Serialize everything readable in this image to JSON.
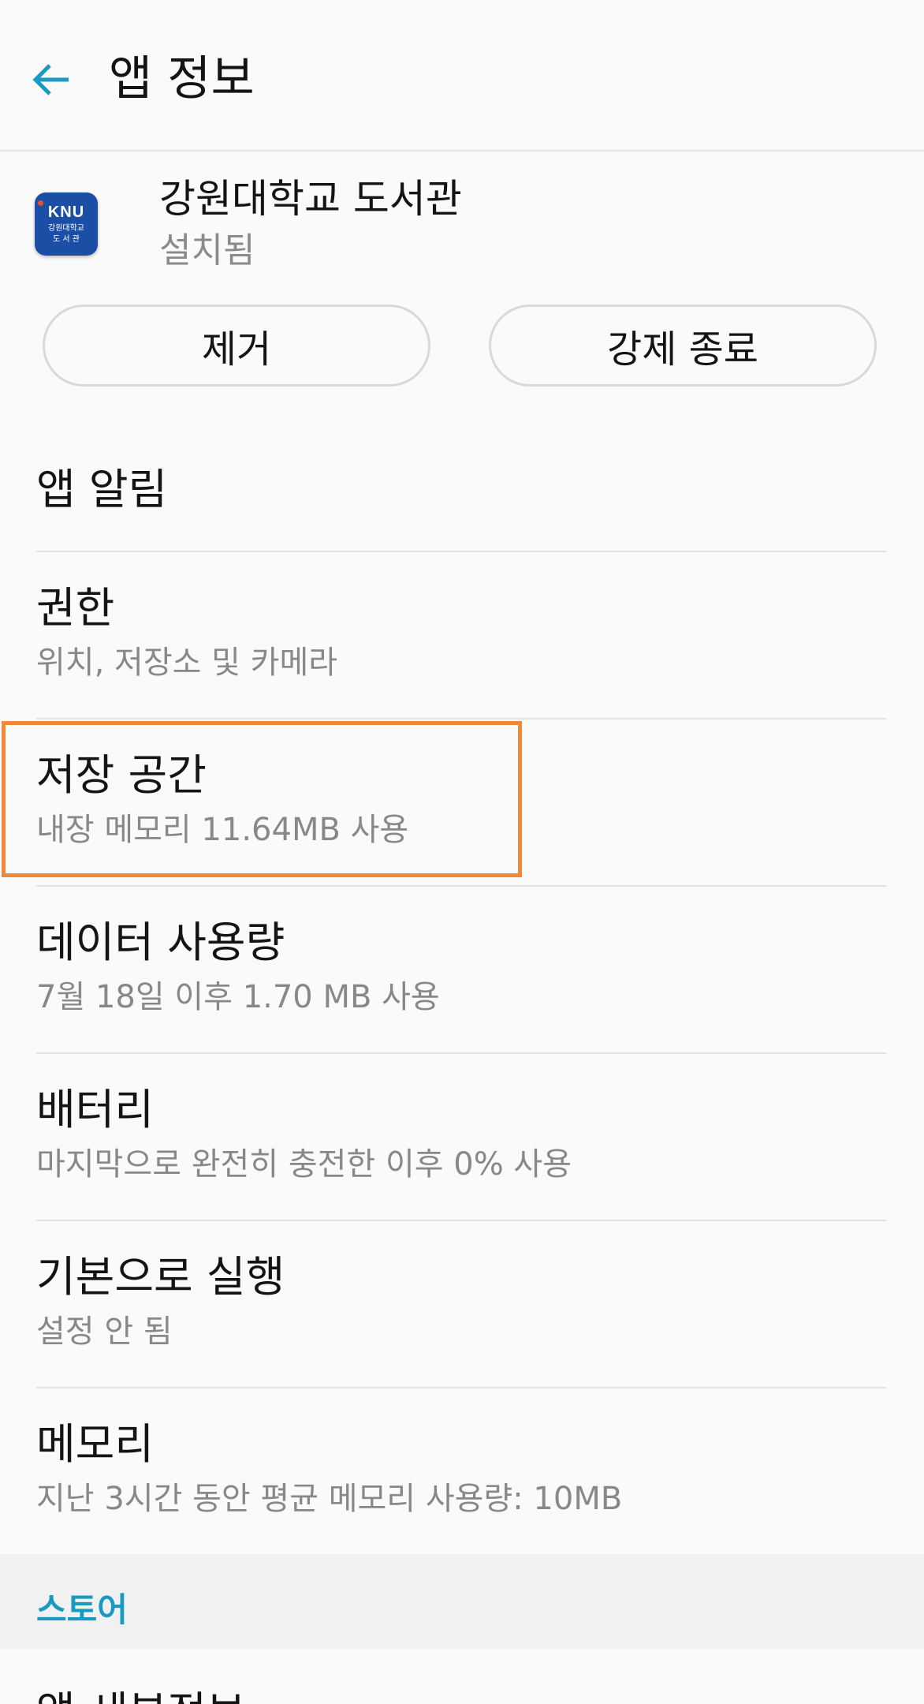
{
  "header": {
    "title": "앱 정보",
    "back_icon": "arrow-left-icon",
    "accent_color": "#1a9ac0"
  },
  "app": {
    "name": "강원대학교 도서관",
    "status": "설치됨",
    "icon": {
      "logo_text": "KNU",
      "logo_line1": "강원대학교",
      "logo_line2": "도 서 관"
    }
  },
  "actions": {
    "uninstall_label": "제거",
    "force_stop_label": "강제 종료"
  },
  "items": [
    {
      "title": "앱 알림",
      "subtitle": ""
    },
    {
      "title": "권한",
      "subtitle": "위치, 저장소 및 카메라"
    },
    {
      "title": "저장 공간",
      "subtitle": "내장 메모리 11.64MB 사용"
    },
    {
      "title": "데이터 사용량",
      "subtitle": "7월 18일 이후 1.70 MB 사용"
    },
    {
      "title": "배터리",
      "subtitle": "마지막으로 완전히 충전한 이후 0% 사용"
    },
    {
      "title": "기본으로 실행",
      "subtitle": "설정 안 됨"
    },
    {
      "title": "메모리",
      "subtitle": "지난 3시간 동안 평균 메모리 사용량: 10MB"
    }
  ],
  "highlight_color": "#f2883a",
  "store_section": {
    "title": "스토어",
    "items": [
      {
        "title": "앱 세부정보"
      }
    ]
  }
}
